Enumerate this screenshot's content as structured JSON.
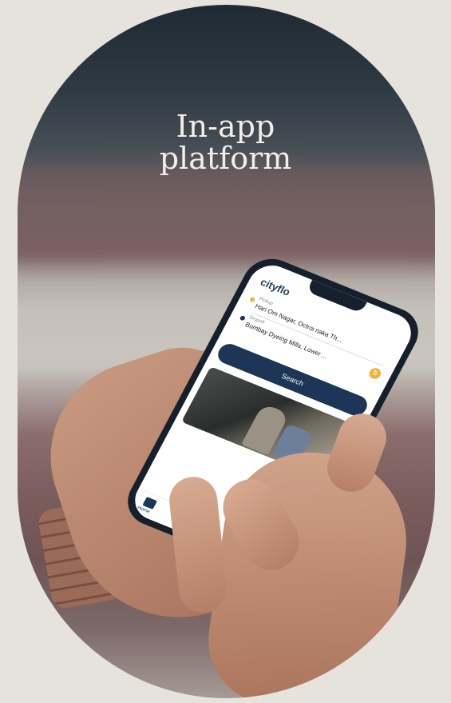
{
  "title": {
    "line1": "In-app",
    "line2": "platform"
  },
  "phone": {
    "brand": "cityflo",
    "pickup_label": "Pickup",
    "pickup_value": "Hari Om Nagar, Octroi naka Th...",
    "dropoff_label": "Dropoff",
    "dropoff_value": "Bombay Dyeing Mills, Lower ...",
    "search_label": "Search",
    "tab_home_label": "Home"
  },
  "colors": {
    "background": "#e6e2dc",
    "title_text": "#f3efe8",
    "brand_navy": "#1d3557",
    "accent_yellow": "#f2b33a"
  },
  "icons": [
    "swap-icon",
    "home-icon"
  ]
}
